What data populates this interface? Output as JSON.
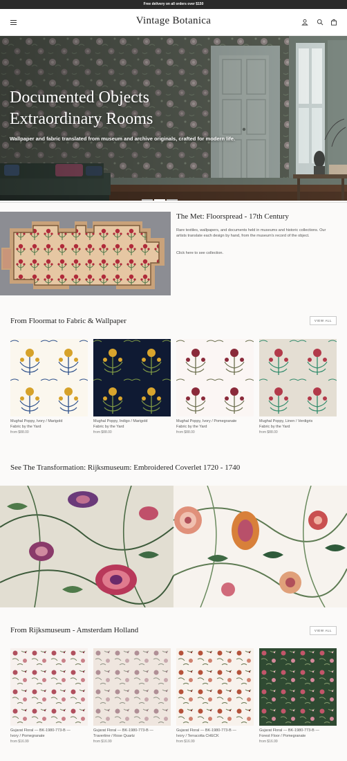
{
  "announcement": "Free delivery on all orders over $150",
  "header": {
    "logo": "Vintage Botanica",
    "icons": [
      "menu-icon",
      "account-icon",
      "search-icon",
      "cart-icon"
    ]
  },
  "hero": {
    "headline_line1": "Documented Objects",
    "headline_line2": "Extraordinary Rooms",
    "subtitle": "Wallpaper and fabric translated from museum and archive originals, crafted for modern life.",
    "slides": 3,
    "active_slide": 2
  },
  "met": {
    "title": "The Met: Floorspread - 17th Century",
    "description": "Rare textiles, wallpapers, and documents held in museums and historic collections. Our artists translate each design by hand, from the museum's record of the object.",
    "link": "Click here to see collection."
  },
  "section1": {
    "title": "From Floormat to Fabric & Wallpaper",
    "view_all": "VIEW ALL",
    "products": [
      {
        "name_line1": "Mughal Poppy, Ivory / Marigold",
        "name_line2": "Fabric by the Yard",
        "price": "from $88.00"
      },
      {
        "name_line1": "Mughal Poppy, Indigo / Marigold",
        "name_line2": "Fabric by the Yard",
        "price": "from $88.00"
      },
      {
        "name_line1": "Mughal Poppy, Ivory / Pomegranate",
        "name_line2": "Fabric by the Yard",
        "price": "from $88.00"
      },
      {
        "name_line1": "Mughal Poppy, Linen / Verdigris",
        "name_line2": "Fabric by the Yard",
        "price": "from $88.00"
      }
    ]
  },
  "transformation": {
    "title": "See The Transformation: Rijksmuseum: Embroidered Coverlet 1720 - 1740"
  },
  "section2": {
    "title": "From Rijksmuseum - Amsterdam Holland",
    "view_all": "VIEW ALL",
    "products": [
      {
        "name_line1": "Gujarat Floral — BK-1980-773-B —",
        "name_line2": "Ivory / Pomegranate",
        "price": "from $16.99"
      },
      {
        "name_line1": "Gujarat Floral — BK-1980-773-B —",
        "name_line2": "Travertine / Rose Quartz",
        "price": "from $16.99"
      },
      {
        "name_line1": "Gujarat Floral — BK-1980-773-B —",
        "name_line2": "Ivory / Terracotta CHECK",
        "price": "from $16.99"
      },
      {
        "name_line1": "Gujarat Floral — BK-1980-773-B —",
        "name_line2": "Forest Floor / Pomegranate",
        "price": "from $16.99"
      }
    ]
  },
  "colors": {
    "announcement_bg": "#2a2a2a",
    "page_bg": "#fbfaf9",
    "marigold": "#d6a22a",
    "indigo": "#0f1a33",
    "pomegranate": "#8a2a3a",
    "verdigris": "#2f8a6a",
    "forest": "#2f4a32"
  }
}
